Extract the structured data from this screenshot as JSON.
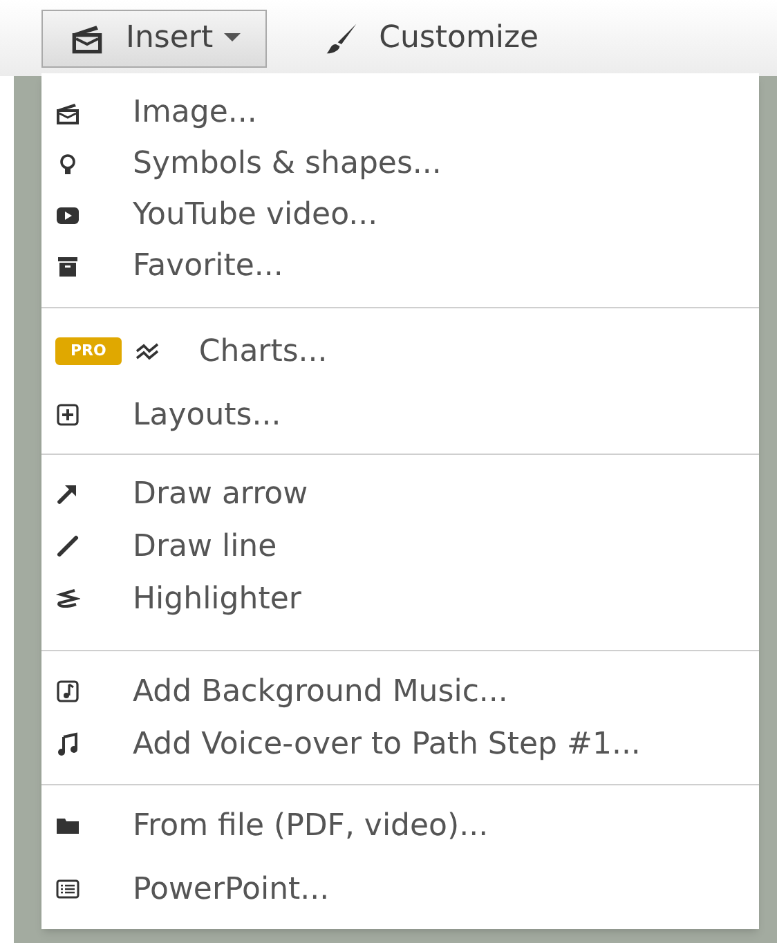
{
  "toolbar": [
    {
      "label": "Insert",
      "selected": true,
      "caret": true
    },
    {
      "label": "Customize",
      "selected": false,
      "caret": false
    }
  ],
  "menu": {
    "sections": [
      {
        "items": [
          {
            "label": "Image..."
          },
          {
            "label": "Symbols & shapes..."
          },
          {
            "label": "YouTube video..."
          },
          {
            "label": "Favorite..."
          }
        ]
      },
      {
        "items": [
          {
            "label": "Charts...",
            "badge": "PRO"
          },
          {
            "label": "Layouts..."
          }
        ]
      },
      {
        "items": [
          {
            "label": "Draw arrow"
          },
          {
            "label": "Draw line"
          },
          {
            "label": "Highlighter"
          }
        ]
      },
      {
        "items": [
          {
            "label": "Add Background Music..."
          },
          {
            "label": "Add Voice-over to Path Step #1..."
          }
        ]
      },
      {
        "items": [
          {
            "label": "From file (PDF, video)..."
          },
          {
            "label": "PowerPoint..."
          }
        ]
      }
    ]
  }
}
